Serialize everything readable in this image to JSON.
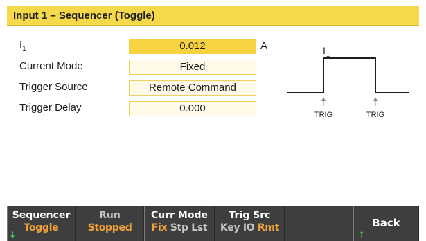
{
  "title": "Input 1 – Sequencer (Toggle)",
  "rows": [
    {
      "label_main": "I",
      "label_sub": "1",
      "value": "0.012",
      "unit": "A"
    },
    {
      "label": "Current Mode",
      "value": "Fixed"
    },
    {
      "label": "Trigger Source",
      "value": "Remote Command"
    },
    {
      "label": "Trigger Delay",
      "value": "0.000"
    }
  ],
  "diagram": {
    "level_main": "I",
    "level_sub": "1",
    "trig_left": "TRIG",
    "trig_right": "TRIG"
  },
  "softkeys": [
    {
      "line1": "Sequencer",
      "line2": "Toggle"
    },
    {
      "line1": "Run",
      "line2": "Stopped"
    },
    {
      "line1": "Curr Mode",
      "opt1": "Fix",
      "opt2": "Stp",
      "opt3": "Lst"
    },
    {
      "line1": "Trig Src",
      "opt1": "Key",
      "opt2": "IO",
      "opt3": "Rmt"
    },
    {
      "line1": ""
    },
    {
      "line1": "Back"
    }
  ],
  "colors": {
    "title_bar": "#f5d94a",
    "active_field": "#f7d342",
    "softkey_bg": "#3e3e3e",
    "softkey_accent": "#f2a33a",
    "arrow_green": "#3ad15a"
  }
}
